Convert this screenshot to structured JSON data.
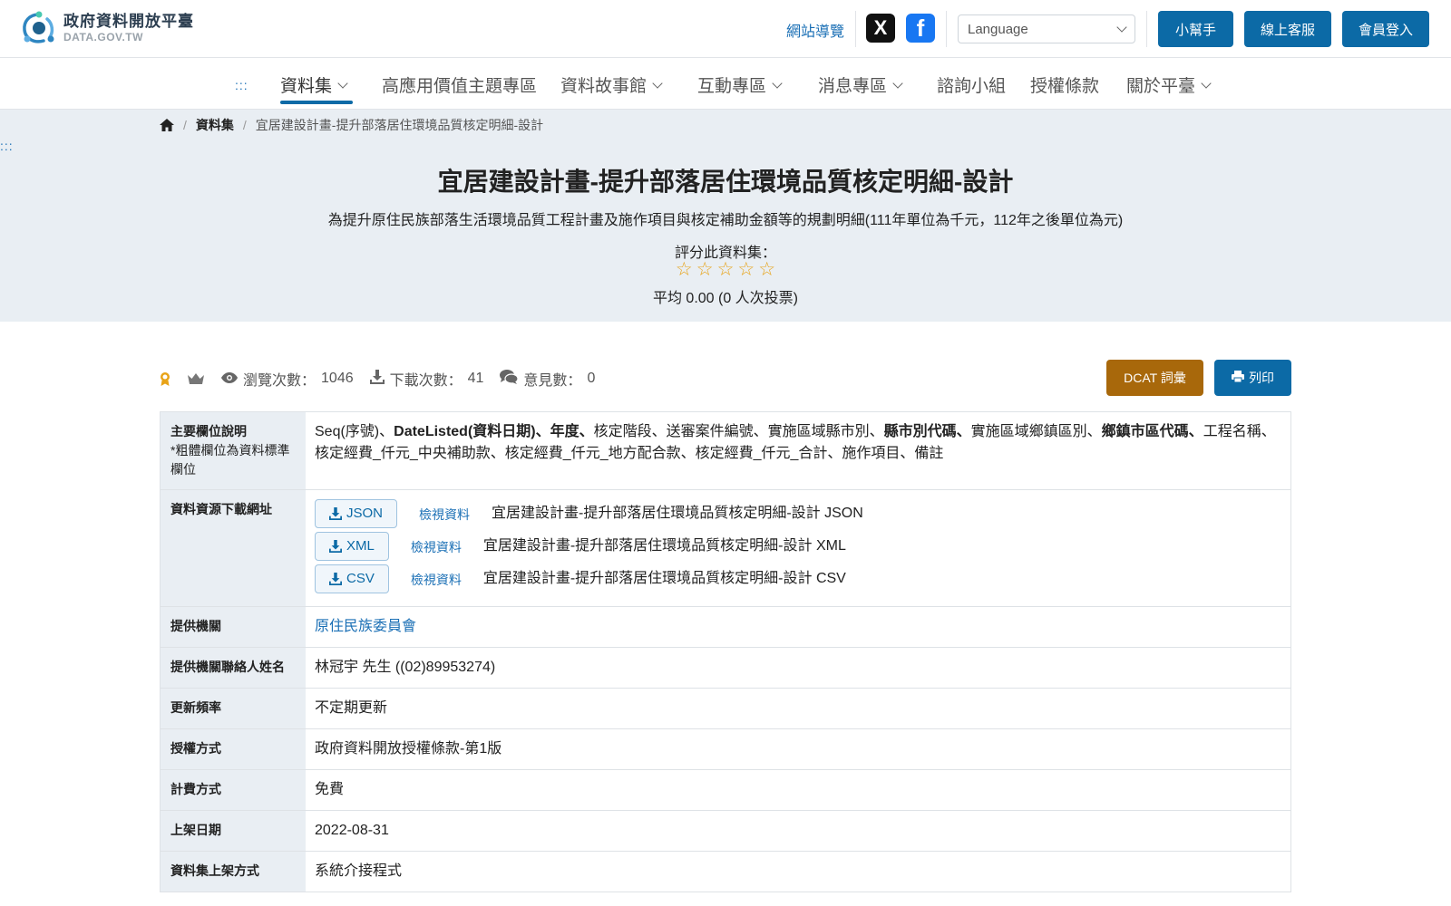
{
  "header": {
    "logo_cn": "政府資料開放平臺",
    "logo_en": "DATA.GOV.TW",
    "sitemap": "網站導覽",
    "social_x": "X",
    "social_fb": "f",
    "language_placeholder": "Language",
    "help_button": "小幫手",
    "service_button": "線上客服",
    "login_button": "會員登入"
  },
  "nav": {
    "accesskey": ":::",
    "items": [
      "資料集",
      "高應用價值主題專區",
      "資料故事館",
      "互動專區",
      "消息專區",
      "諮詢小組",
      "授權條款",
      "關於平臺"
    ]
  },
  "breadcrumb": {
    "level1": "資料集",
    "current": "宜居建設計畫-提升部落居住環境品質核定明細-設計"
  },
  "hero": {
    "accesskey": ":::",
    "title": "宜居建設計畫-提升部落居住環境品質核定明細-設計",
    "description": "為提升原住民族部落生活環境品質工程計畫及施作項目與核定補助金額等的規劃明細(111年單位為千元，112年之後單位為元)",
    "rating_label": "評分此資料集：",
    "rating_value": 0,
    "rating_max": 5,
    "average": "平均 0.00 (0 人次投票)"
  },
  "stats": {
    "views_label": "瀏覽次數：",
    "views": "1046",
    "downloads_label": "下載次數：",
    "downloads": "41",
    "comments_label": "意見數：",
    "comments": "0",
    "dcat_button": "DCAT 詞彙",
    "print_button": "列印"
  },
  "table": {
    "fields_header": "主要欄位說明",
    "fields_note": "*粗體欄位為資料標準欄位",
    "fields": [
      {
        "text": "Seq(序號)、",
        "bold": false
      },
      {
        "text": "DateListed(資料日期)、",
        "bold": true
      },
      {
        "text": "年度、",
        "bold": true
      },
      {
        "text": "核定階段、送審案件編號、實施區域縣市別、",
        "bold": false
      },
      {
        "text": "縣市別代碼、",
        "bold": true
      },
      {
        "text": "實施區域鄉鎮區別、",
        "bold": false
      },
      {
        "text": "鄉鎮市區代碼、",
        "bold": true
      },
      {
        "text": "工程名稱、核定經費_仟元_中央補助款、核定經費_仟元_地方配合款、核定經費_仟元_合計、施作項目、備註",
        "bold": false
      }
    ],
    "download_header": "資料資源下載網址",
    "downloads": [
      {
        "format": "JSON",
        "view": "檢視資料",
        "name": "宜居建設計畫-提升部落居住環境品質核定明細-設計 JSON"
      },
      {
        "format": "XML",
        "view": "檢視資料",
        "name": "宜居建設計畫-提升部落居住環境品質核定明細-設計 XML"
      },
      {
        "format": "CSV",
        "view": "檢視資料",
        "name": "宜居建設計畫-提升部落居住環境品質核定明細-設計 CSV"
      }
    ],
    "org_header": "提供機關",
    "org": "原住民族委員會",
    "contact_header": "提供機關聯絡人姓名",
    "contact": "林冠宇 先生 ((02)89953274)",
    "freq_header": "更新頻率",
    "freq": "不定期更新",
    "license_header": "授權方式",
    "license": "政府資料開放授權條款-第1版",
    "fee_header": "計費方式",
    "fee": "免費",
    "date_header": "上架日期",
    "date": "2022-08-31",
    "method_header": "資料集上架方式",
    "method": "系統介接程式"
  }
}
